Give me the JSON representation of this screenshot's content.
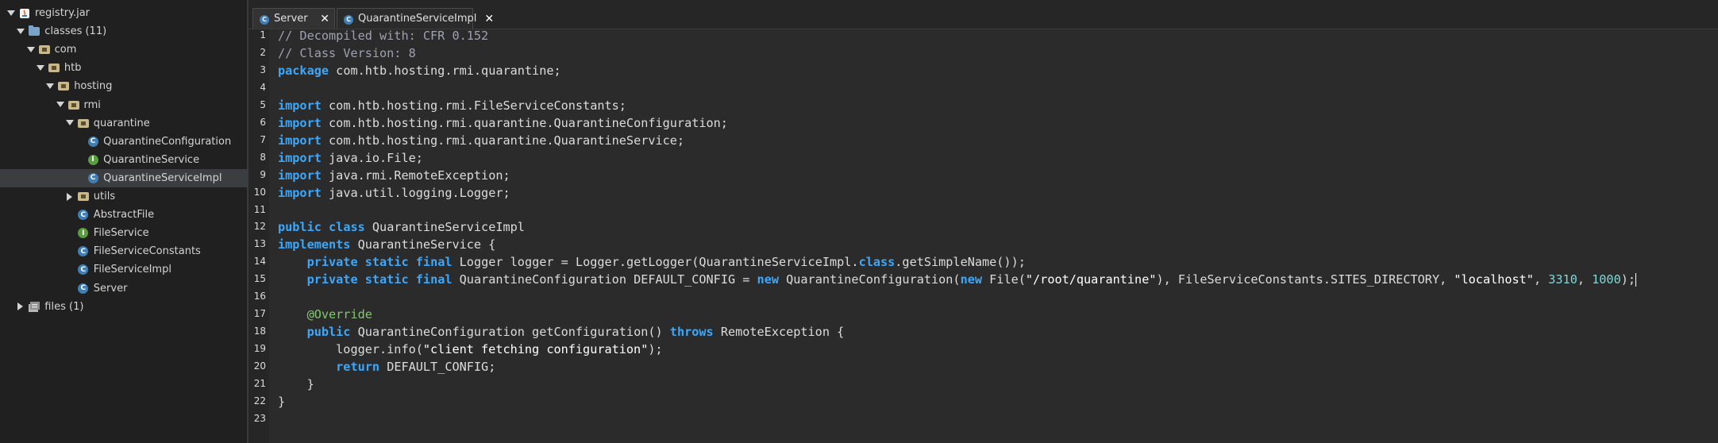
{
  "tree": {
    "items": [
      {
        "label": "registry.jar",
        "depth": 0,
        "toggle": "open",
        "icon": "jar-icon"
      },
      {
        "label": "classes (11)",
        "depth": 1,
        "toggle": "open",
        "icon": "folder-icon"
      },
      {
        "label": "com",
        "depth": 2,
        "toggle": "open",
        "icon": "package-icon"
      },
      {
        "label": "htb",
        "depth": 3,
        "toggle": "open",
        "icon": "package-icon"
      },
      {
        "label": "hosting",
        "depth": 4,
        "toggle": "open",
        "icon": "package-icon"
      },
      {
        "label": "rmi",
        "depth": 5,
        "toggle": "open",
        "icon": "package-icon"
      },
      {
        "label": "quarantine",
        "depth": 6,
        "toggle": "open",
        "icon": "package-icon"
      },
      {
        "label": "QuarantineConfiguration",
        "depth": 7,
        "toggle": "none",
        "icon": "class-icon"
      },
      {
        "label": "QuarantineService",
        "depth": 7,
        "toggle": "none",
        "icon": "interface-icon"
      },
      {
        "label": "QuarantineServiceImpl",
        "depth": 7,
        "toggle": "none",
        "icon": "class-icon",
        "selected": true
      },
      {
        "label": "utils",
        "depth": 6,
        "toggle": "closed",
        "icon": "package-icon"
      },
      {
        "label": "AbstractFile",
        "depth": 6,
        "toggle": "none",
        "icon": "class-icon"
      },
      {
        "label": "FileService",
        "depth": 6,
        "toggle": "none",
        "icon": "interface-icon"
      },
      {
        "label": "FileServiceConstants",
        "depth": 6,
        "toggle": "none",
        "icon": "class-icon"
      },
      {
        "label": "FileServiceImpl",
        "depth": 6,
        "toggle": "none",
        "icon": "class-icon"
      },
      {
        "label": "Server",
        "depth": 6,
        "toggle": "none",
        "icon": "class-icon"
      },
      {
        "label": "files (1)",
        "depth": 1,
        "toggle": "closed",
        "icon": "files-folder-icon"
      }
    ]
  },
  "tabs": [
    {
      "label": "Server",
      "close": "✕",
      "active": false
    },
    {
      "label": "QuarantineServiceImpl",
      "close": "✕",
      "active": true
    }
  ],
  "editor": {
    "lines": [
      [
        [
          "cm",
          "// Decompiled with: CFR 0.152"
        ]
      ],
      [
        [
          "cm",
          "// Class Version: 8"
        ]
      ],
      [
        [
          "kw",
          "package"
        ],
        [
          "",
          "com.htb.hosting.rmi.quarantine;"
        ]
      ],
      [],
      [
        [
          "kw",
          "import"
        ],
        [
          "",
          "com.htb.hosting.rmi.FileServiceConstants;"
        ]
      ],
      [
        [
          "kw",
          "import"
        ],
        [
          "",
          "com.htb.hosting.rmi.quarantine.QuarantineConfiguration;"
        ]
      ],
      [
        [
          "kw",
          "import"
        ],
        [
          "",
          "com.htb.hosting.rmi.quarantine.QuarantineService;"
        ]
      ],
      [
        [
          "kw",
          "import"
        ],
        [
          "",
          "java.io.File;"
        ]
      ],
      [
        [
          "kw",
          "import"
        ],
        [
          "",
          "java.rmi.RemoteException;"
        ]
      ],
      [
        [
          "kw",
          "import"
        ],
        [
          "",
          "java.util.logging.Logger;"
        ]
      ],
      [],
      [
        [
          "kw",
          "public"
        ],
        [
          "kw",
          "class"
        ],
        [
          "",
          "QuarantineServiceImpl"
        ]
      ],
      [
        [
          "kw",
          "implements"
        ],
        [
          "",
          "QuarantineService {"
        ]
      ],
      [
        [
          "ws",
          "    "
        ],
        [
          "kw",
          "private"
        ],
        [
          "kw",
          "static"
        ],
        [
          "kw",
          "final"
        ],
        [
          "",
          "Logger logger = Logger.getLogger(QuarantineServiceImpl."
        ],
        [
          "kwn",
          "class"
        ],
        [
          "n",
          ".getSimpleName());"
        ]
      ],
      [
        [
          "ws",
          "    "
        ],
        [
          "kw",
          "private"
        ],
        [
          "kw",
          "static"
        ],
        [
          "kw",
          "final"
        ],
        [
          "",
          "QuarantineConfiguration DEFAULT_CONFIG = "
        ],
        [
          "kwn",
          "new"
        ],
        [
          "n",
          " QuarantineConfiguration("
        ],
        [
          "kwn",
          "new"
        ],
        [
          "n",
          " File("
        ],
        [
          "str",
          "\"/root/quarantine\""
        ],
        [
          "n",
          "), FileServiceConstants.SITES_DIRECTORY, "
        ],
        [
          "str",
          "\"localhost\""
        ],
        [
          "n",
          ", "
        ],
        [
          "num",
          "3310"
        ],
        [
          "n",
          ", "
        ],
        [
          "num",
          "1000"
        ],
        [
          "n",
          ");"
        ],
        [
          "caret",
          ""
        ]
      ],
      [],
      [
        [
          "ws",
          "    "
        ],
        [
          "ann",
          "@Override"
        ]
      ],
      [
        [
          "ws",
          "    "
        ],
        [
          "kw",
          "public"
        ],
        [
          "",
          "QuarantineConfiguration getConfiguration() "
        ],
        [
          "kwn",
          "throws"
        ],
        [
          "n",
          " RemoteException {"
        ]
      ],
      [
        [
          "ws",
          "        "
        ],
        [
          "",
          "logger.info("
        ],
        [
          "str",
          "\"client fetching configuration\""
        ],
        [
          "n",
          ");"
        ]
      ],
      [
        [
          "ws",
          "        "
        ],
        [
          "kw",
          "return"
        ],
        [
          "",
          "DEFAULT_CONFIG;"
        ]
      ],
      [
        [
          "ws",
          "    "
        ],
        [
          "",
          "}"
        ]
      ],
      [
        [
          "",
          "}"
        ]
      ],
      []
    ]
  },
  "colors": {
    "keyword": "#3aa8ff",
    "comment": "#a0a0b0",
    "annotation": "#82c96b",
    "number": "#7fd7d7",
    "class_icon": "#3f7fb5",
    "interface_icon": "#5a9c3e"
  }
}
